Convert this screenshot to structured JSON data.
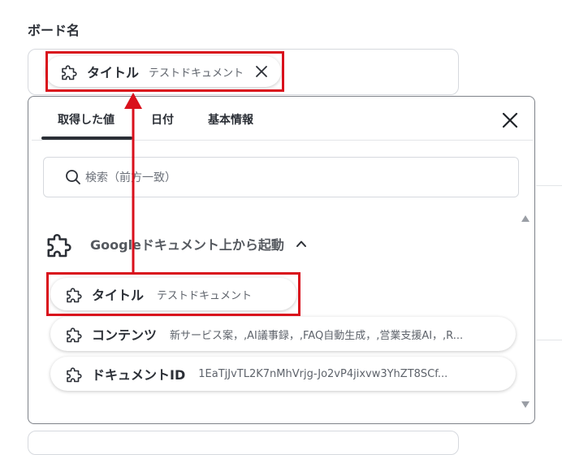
{
  "field": {
    "label": "ボード名"
  },
  "board_input": {
    "chip": {
      "title": "タイトル",
      "subtitle": "テストドキュメント"
    }
  },
  "popup": {
    "tabs": [
      {
        "label": "取得した値",
        "active": true
      },
      {
        "label": "日付",
        "active": false
      },
      {
        "label": "基本情報",
        "active": false
      }
    ],
    "search": {
      "placeholder": "検索（前方一致）"
    },
    "group": {
      "title": "Googleドキュメント上から起動",
      "items": [
        {
          "title": "タイトル",
          "value": "テストドキュメント"
        },
        {
          "title": "コンテンツ",
          "value": "新サービス案，,AI議事録，,FAQ自動生成，,営業支援AI，,R..."
        },
        {
          "title": "ドキュメントID",
          "value": "1EaTjJvTL2K7nMhVrjg-Jo2vP4jixvw3YhZT8SCf..."
        }
      ]
    }
  },
  "annotation": {
    "color": "#d9101c"
  },
  "icons": [
    "puzzle-icon",
    "close-icon",
    "search-icon",
    "chevron-up-icon"
  ]
}
